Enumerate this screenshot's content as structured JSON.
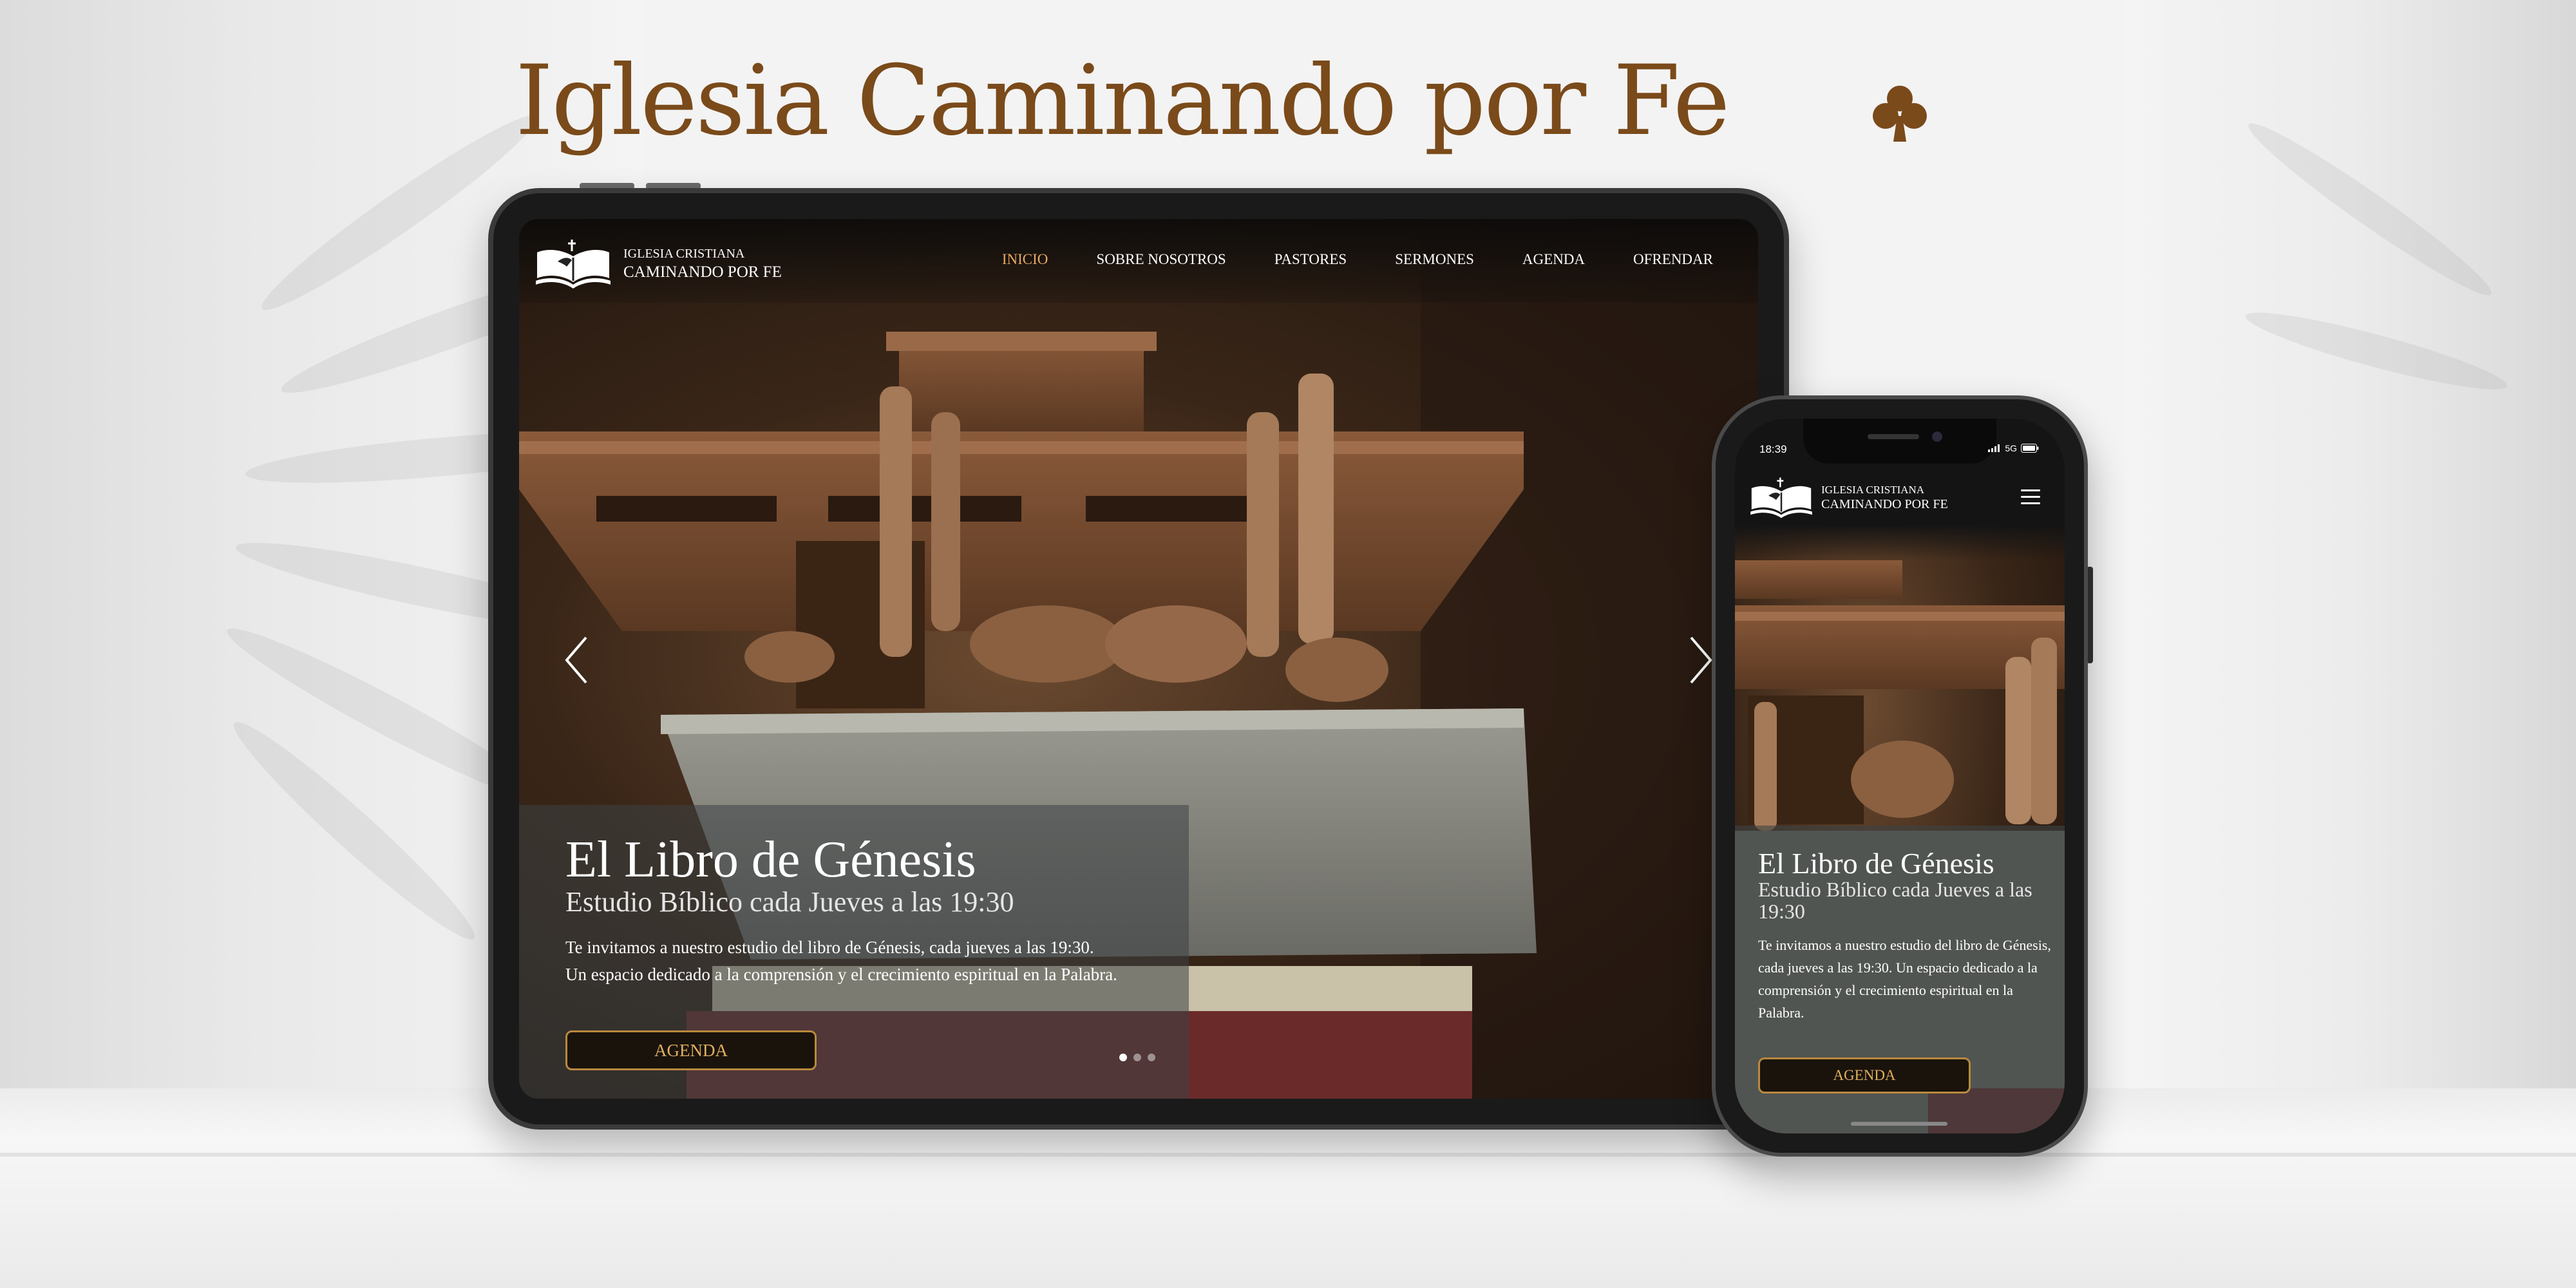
{
  "page": {
    "title": "Iglesia Caminando por Fe",
    "accent_color": "#7a4a1a",
    "decoration_icon": "club-icon"
  },
  "site": {
    "logo": {
      "line1": "IGLESIA CRISTIANA",
      "line2": "CAMINANDO POR FE",
      "icon": "open-book-icon"
    },
    "nav": [
      {
        "label": "INICIO",
        "active": true
      },
      {
        "label": "SOBRE NOSOTROS",
        "active": false
      },
      {
        "label": "PASTORES",
        "active": false
      },
      {
        "label": "SERMONES",
        "active": false
      },
      {
        "label": "AGENDA",
        "active": false
      },
      {
        "label": "OFRENDAR",
        "active": false
      }
    ],
    "nav_active_color": "#e8a863",
    "hero": {
      "title": "El Libro de Génesis",
      "subtitle": "Estudio Bíblico cada Jueves a las 19:30",
      "text_line1": "Te invitamos a nuestro estudio del libro de Génesis, cada jueves a las 19:30.",
      "text_line2": "Un espacio dedicado a la comprensión y el crecimiento espiritual en la Palabra.",
      "button": "AGENDA",
      "button_color": "#e0b060",
      "slides_total": 3,
      "slide_current": 1
    }
  },
  "phone": {
    "status_time": "18:39",
    "status_network": "5G",
    "menu_icon": "hamburger-menu-icon"
  }
}
